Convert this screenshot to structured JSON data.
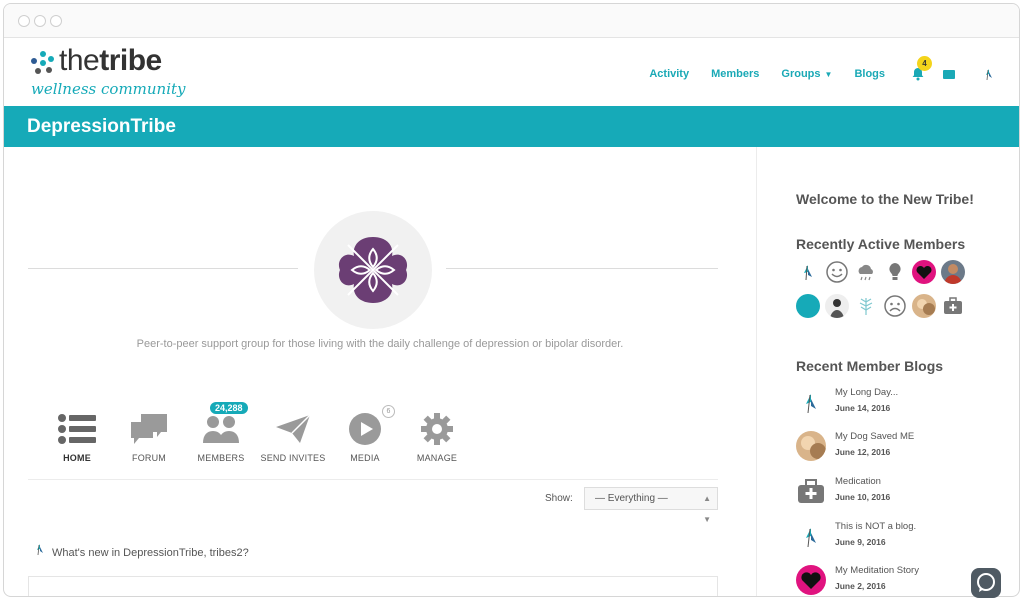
{
  "brand": {
    "name_light": "the",
    "name_bold": "tribe",
    "tagline": "wellness community"
  },
  "nav": {
    "items": [
      {
        "label": "Activity"
      },
      {
        "label": "Members"
      },
      {
        "label": "Groups",
        "has_caret": true
      },
      {
        "label": "Blogs"
      }
    ],
    "notification_count": "4"
  },
  "group": {
    "title": "DepressionTribe",
    "description": "Peer-to-peer support group for those living with the daily challenge of depression or bipolar disorder."
  },
  "tabs": [
    {
      "label": "HOME",
      "icon": "list-icon",
      "active": true
    },
    {
      "label": "FORUM",
      "icon": "chat-bubbles-icon"
    },
    {
      "label": "MEMBERS",
      "icon": "people-icon",
      "badge": "24,288"
    },
    {
      "label": "SEND INVITES",
      "icon": "paper-plane-icon"
    },
    {
      "label": "MEDIA",
      "icon": "play-icon",
      "badge": "6"
    },
    {
      "label": "MANAGE",
      "icon": "gear-icon"
    }
  ],
  "filter": {
    "label": "Show:",
    "value": "— Everything —"
  },
  "whats_new": "What's new in DepressionTribe, tribes2?",
  "sidebar": {
    "welcome": "Welcome to the New Tribe!",
    "active_members_title": "Recently Active Members",
    "blogs_title": "Recent Member Blogs",
    "blogs": [
      {
        "title": "My Long Day...",
        "date": "June 14, 2016",
        "avatar": "butterfly"
      },
      {
        "title": "My Dog Saved ME",
        "date": "June 12, 2016",
        "avatar": "photo"
      },
      {
        "title": "Medication",
        "date": "June 10, 2016",
        "avatar": "medkit"
      },
      {
        "title": "This is NOT a blog.",
        "date": "June 9, 2016",
        "avatar": "butterfly"
      },
      {
        "title": "My Meditation Story",
        "date": "June 2, 2016",
        "avatar": "heart"
      }
    ]
  },
  "colors": {
    "accent": "#16aab8",
    "badge": "#f4d41b",
    "purple": "#6b3e74",
    "magenta": "#e0137f"
  }
}
